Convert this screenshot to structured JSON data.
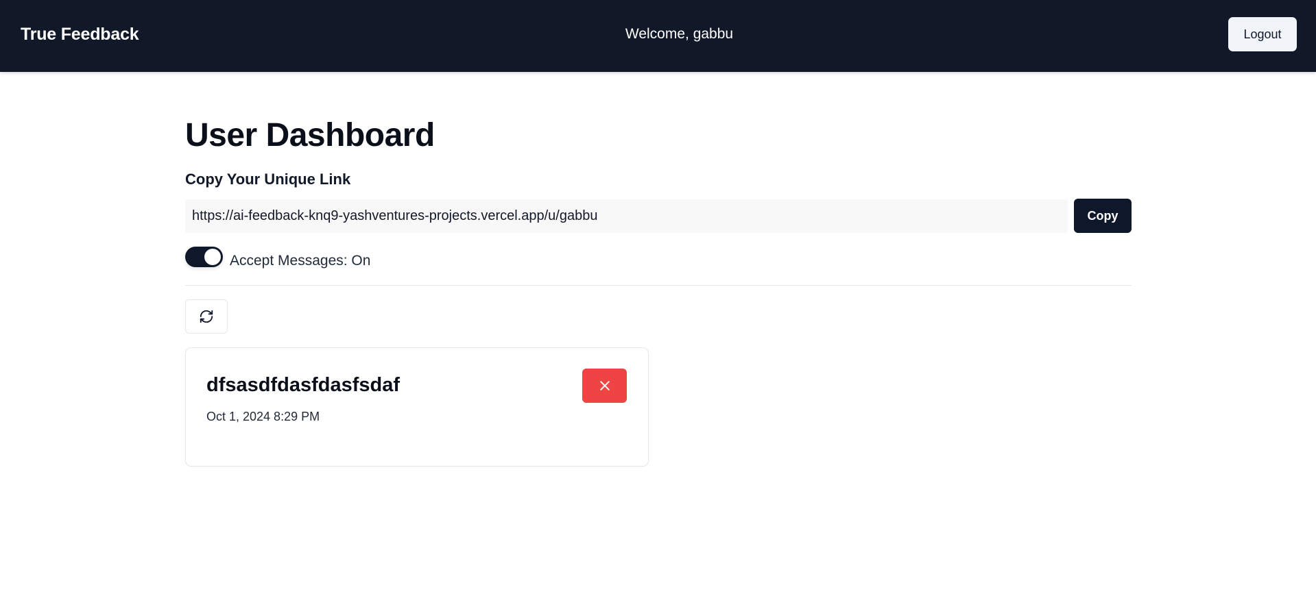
{
  "header": {
    "brand": "True Feedback",
    "welcome": "Welcome, gabbu",
    "logout_label": "Logout"
  },
  "main": {
    "title": "User Dashboard",
    "link_section_label": "Copy Your Unique Link",
    "unique_link": "https://ai-feedback-knq9-yashventures-projects.vercel.app/u/gabbu",
    "copy_label": "Copy",
    "accept_messages": {
      "label": "Accept Messages: On",
      "enabled": true
    },
    "refresh_icon": "refresh-icon"
  },
  "messages": [
    {
      "content": "dfsasdfdasfdasfsdaf",
      "created_at": "Oct 1, 2024 8:29 PM",
      "delete_icon": "close-icon"
    }
  ],
  "colors": {
    "navbar_bg": "#111827",
    "primary": "#0f172a",
    "danger": "#ef4444"
  }
}
